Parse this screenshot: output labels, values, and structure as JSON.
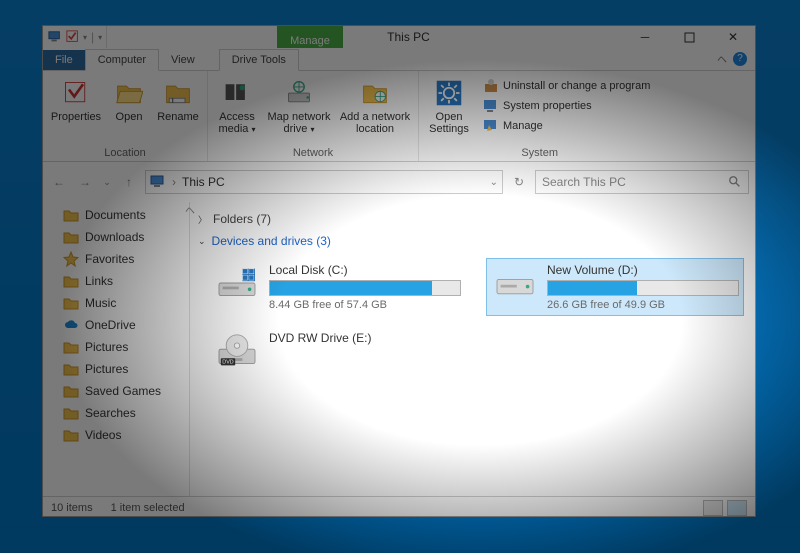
{
  "window": {
    "title": "This PC"
  },
  "qat": {
    "manage": "Manage"
  },
  "tabs": {
    "file": "File",
    "computer": "Computer",
    "view": "View",
    "drivetools": "Drive Tools"
  },
  "ribbon": {
    "location": {
      "label": "Location",
      "properties": "Properties",
      "open": "Open",
      "rename": "Rename"
    },
    "network": {
      "label": "Network",
      "access_media": "Access media",
      "map_drive": "Map network drive",
      "add_location": "Add a network location"
    },
    "system": {
      "label": "System",
      "open_settings": "Open Settings",
      "uninstall": "Uninstall or change a program",
      "sysprops": "System properties",
      "manage": "Manage"
    }
  },
  "addressbar": {
    "path": "This PC",
    "search_placeholder": "Search This PC"
  },
  "navpane": {
    "items": [
      {
        "label": "Documents",
        "icon": "folder"
      },
      {
        "label": "Downloads",
        "icon": "folder"
      },
      {
        "label": "Favorites",
        "icon": "star"
      },
      {
        "label": "Links",
        "icon": "folder"
      },
      {
        "label": "Music",
        "icon": "folder"
      },
      {
        "label": "OneDrive",
        "icon": "cloud"
      },
      {
        "label": "Pictures",
        "icon": "folder"
      },
      {
        "label": "Pictures",
        "icon": "folder"
      },
      {
        "label": "Saved Games",
        "icon": "folder"
      },
      {
        "label": "Searches",
        "icon": "folder"
      },
      {
        "label": "Videos",
        "icon": "folder"
      }
    ]
  },
  "content": {
    "folders_header": "Folders (7)",
    "devices_header": "Devices and drives (3)",
    "drives": [
      {
        "name": "Local Disk (C:)",
        "free_text": "8.44 GB free of 57.4 GB",
        "fill_pct": 85,
        "type": "os",
        "selected": false
      },
      {
        "name": "New Volume (D:)",
        "free_text": "26.6 GB free of 49.9 GB",
        "fill_pct": 47,
        "type": "hdd",
        "selected": true
      },
      {
        "name": "DVD RW Drive (E:)",
        "free_text": "",
        "fill_pct": null,
        "type": "dvd",
        "selected": false
      }
    ]
  },
  "status": {
    "count": "10 items",
    "selected": "1 item selected"
  }
}
